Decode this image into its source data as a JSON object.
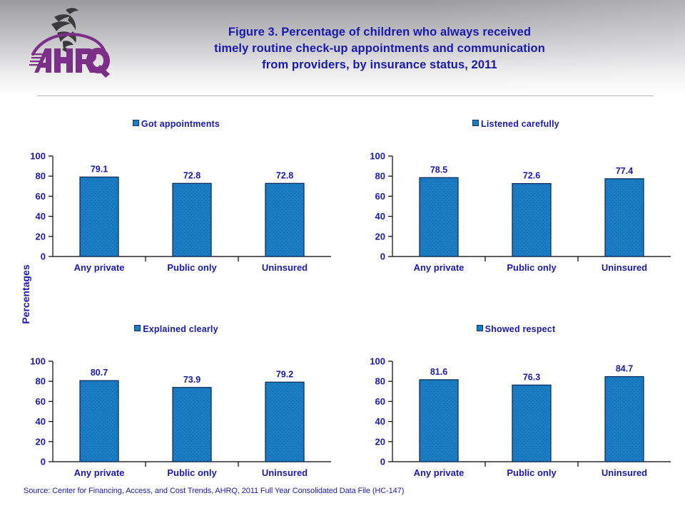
{
  "header": {
    "logo_alt": "AHRQ Agency for Healthcare Research and Quality",
    "title_lines": [
      "Figure 3. Percentage of children who always received",
      "timely routine check-up appointments and communication",
      "from providers, by insurance status, 2011"
    ]
  },
  "axis_group_label": "Percentages",
  "source": "Source: Center for Financing, Access, and Cost Trends, AHRQ,  2011 Full Year Consolidated Data File (HC-147)",
  "colors": {
    "title_blue": "#1a18b0",
    "bar_fill": "#1b7dc4",
    "bar_border": "#0b2f63",
    "axis_black": "#000000",
    "header_gray": "#9b9b9e"
  },
  "chart_data": [
    {
      "type": "bar",
      "title": "Got appointments",
      "categories": [
        "Any private",
        "Public only",
        "Uninsured"
      ],
      "values": [
        79.1,
        72.8,
        72.8
      ],
      "xlabel": "",
      "ylabel": "Percentages",
      "ylim": [
        0,
        100
      ],
      "yticks": [
        0,
        20,
        40,
        60,
        80,
        100
      ],
      "grid": false,
      "legend_position": "top-center"
    },
    {
      "type": "bar",
      "title": "Listened carefully",
      "categories": [
        "Any private",
        "Public only",
        "Uninsured"
      ],
      "values": [
        78.5,
        72.6,
        77.4
      ],
      "xlabel": "",
      "ylabel": "Percentages",
      "ylim": [
        0,
        100
      ],
      "yticks": [
        0,
        20,
        40,
        60,
        80,
        100
      ],
      "grid": false,
      "legend_position": "top-center"
    },
    {
      "type": "bar",
      "title": "Explained clearly",
      "categories": [
        "Any private",
        "Public only",
        "Uninsured"
      ],
      "values": [
        80.7,
        73.9,
        79.2
      ],
      "xlabel": "",
      "ylabel": "Percentages",
      "ylim": [
        0,
        100
      ],
      "yticks": [
        0,
        20,
        40,
        60,
        80,
        100
      ],
      "grid": false,
      "legend_position": "top-center"
    },
    {
      "type": "bar",
      "title": "Showed respect",
      "categories": [
        "Any private",
        "Public only",
        "Uninsured"
      ],
      "values": [
        81.6,
        76.3,
        84.7
      ],
      "xlabel": "",
      "ylabel": "Percentages",
      "ylim": [
        0,
        100
      ],
      "yticks": [
        0,
        20,
        40,
        60,
        80,
        100
      ],
      "grid": false,
      "legend_position": "top-center"
    }
  ]
}
